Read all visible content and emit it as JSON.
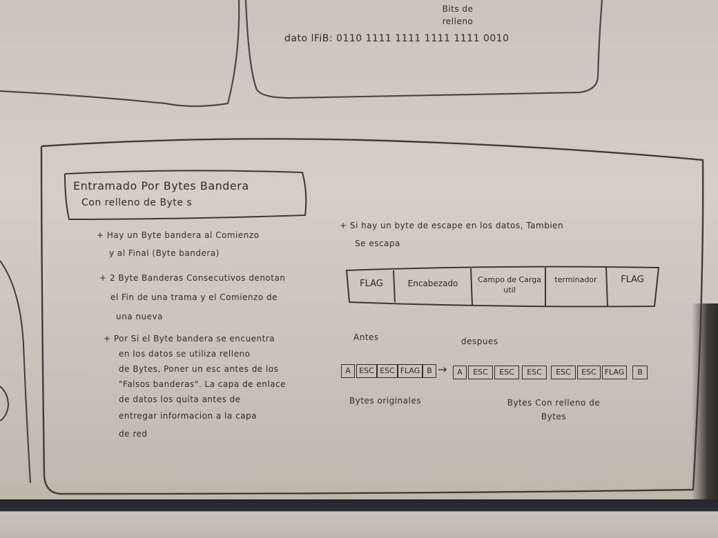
{
  "top_box": {
    "bits_label": "Bits de relleno",
    "data_line": "dato lFiB: 0110 1111 1111 1111 1111 0010"
  },
  "section": {
    "title_line1": "Entramado Por Bytes Bandera",
    "title_line2": "Con relleno de Byte s",
    "bullets": [
      [
        "+ Hay un Byte bandera al Comienzo",
        "y al Final (Byte bandera)"
      ],
      [
        "+ 2 Byte Banderas Consecutivos denotan",
        "el Fin de una trama y el Comienzo de",
        "una nueva"
      ],
      [
        "+ Por Si el Byte bandera se encuentra",
        "en los datos se utiliza relleno",
        "de Bytes, Poner un esc antes de los",
        "\"Falsos banderas\". La capa de enlace",
        "de datos los quita antes de",
        "entregar informacion a la capa",
        "de red"
      ]
    ],
    "right_note": [
      "+ Si hay un byte de escape en los datos, Tambien",
      "Se escapa"
    ]
  },
  "frame_table": {
    "cells": [
      "FLAG",
      "Encabezado",
      "Campo de Carga util",
      "terminador",
      "FLAG"
    ]
  },
  "stuffing": {
    "before_label": "Antes",
    "after_label": "despues",
    "original": [
      "A",
      "ESC",
      "ESC",
      "FLAG",
      "B"
    ],
    "stuffed": [
      "A",
      "ESC",
      "ESC",
      "ESC",
      "ESC",
      "ESC",
      "FLAG",
      "B"
    ],
    "arrow": "→",
    "caption_original": "Bytes originales",
    "caption_stuffed": "Bytes Con relleno de Bytes"
  }
}
